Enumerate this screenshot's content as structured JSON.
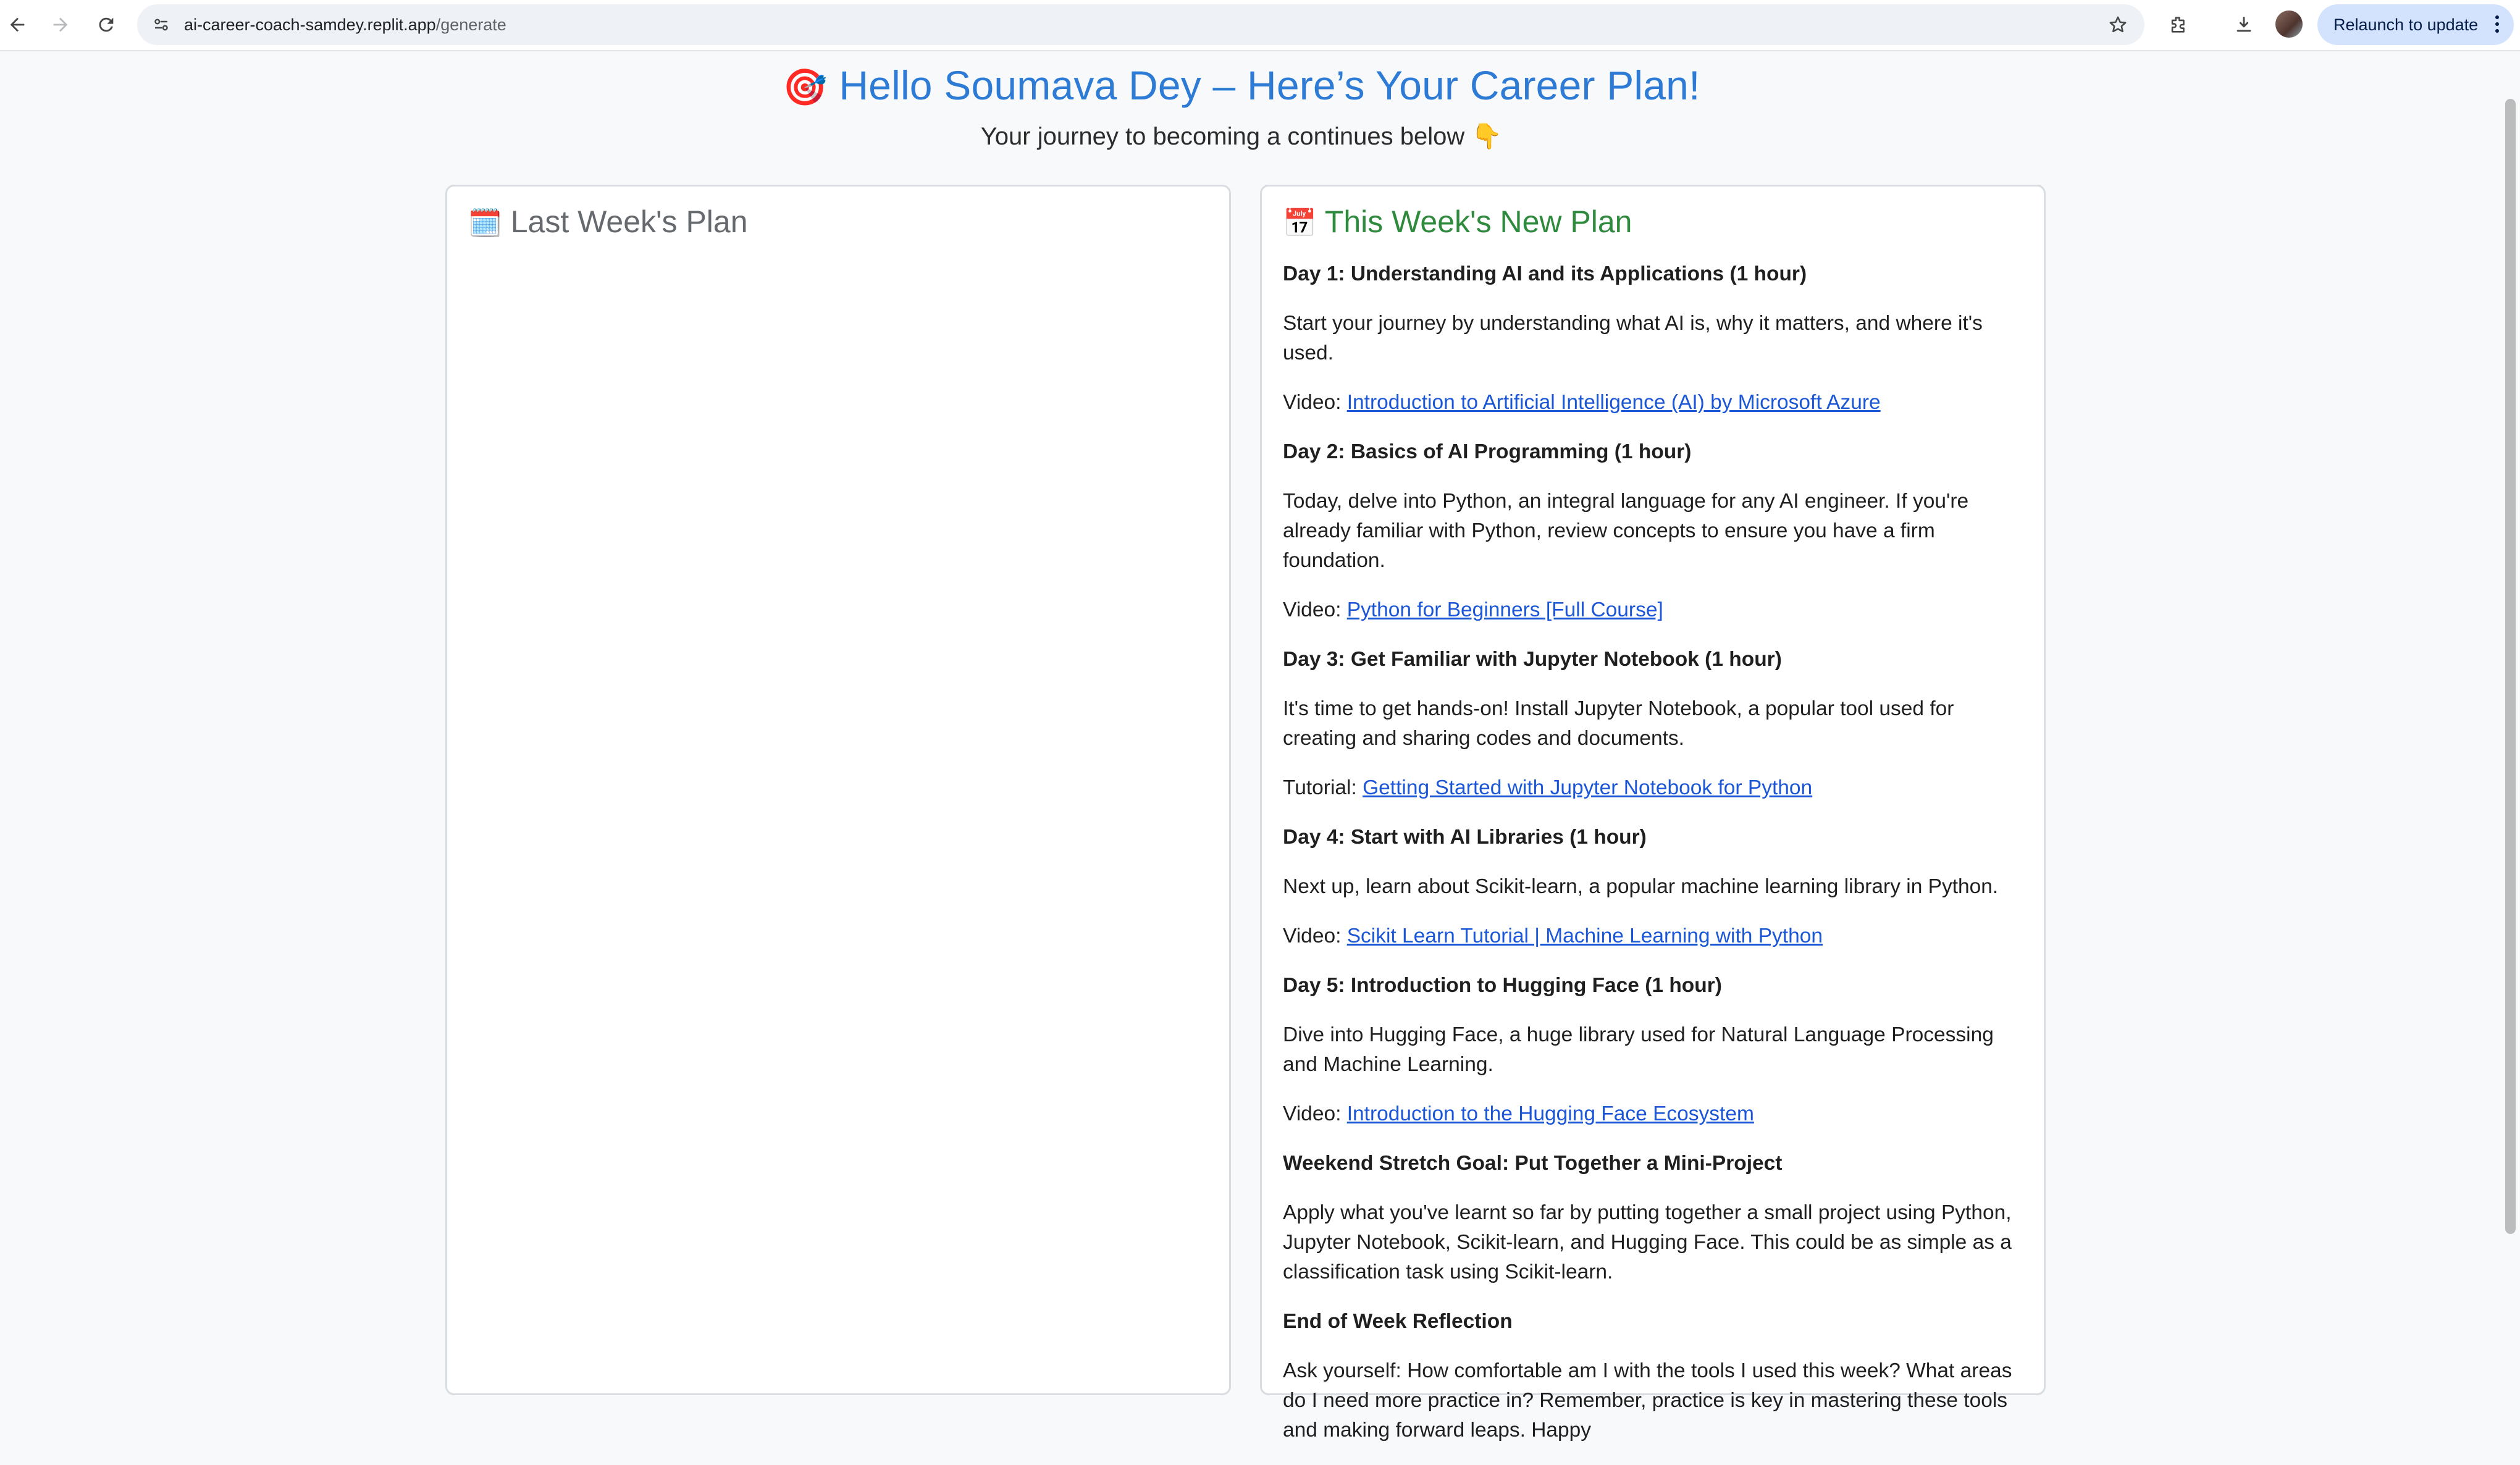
{
  "browser": {
    "url_host": "ai-career-coach-samdey.replit.app",
    "url_path": "/generate",
    "relaunch_label": "Relaunch to update"
  },
  "page": {
    "title_emoji": "🎯",
    "title": "Hello Soumava Dey – Here’s Your Career Plan!",
    "subtitle": "Your journey to becoming a continues below 👇"
  },
  "last_week": {
    "emoji": "🗓️",
    "title": "Last Week's Plan"
  },
  "this_week": {
    "emoji": "📅",
    "title": "This Week's New Plan",
    "day1": {
      "heading": "Day 1: Understanding AI and its Applications (1 hour)",
      "text": "Start your journey by understanding what AI is, why it matters, and where it's used.",
      "res_prefix": "Video: ",
      "res_link": "Introduction to Artificial Intelligence (AI) by Microsoft Azure"
    },
    "day2": {
      "heading": "Day 2: Basics of AI Programming (1 hour)",
      "text": "Today, delve into Python, an integral language for any AI engineer. If you're already familiar with Python, review concepts to ensure you have a firm foundation.",
      "res_prefix": "Video: ",
      "res_link": "Python for Beginners [Full Course]"
    },
    "day3": {
      "heading": "Day 3: Get Familiar with Jupyter Notebook (1 hour)",
      "text": "It's time to get hands-on! Install Jupyter Notebook, a popular tool used for creating and sharing codes and documents.",
      "res_prefix": "Tutorial: ",
      "res_link": "Getting Started with Jupyter Notebook for Python"
    },
    "day4": {
      "heading": "Day 4: Start with AI Libraries (1 hour)",
      "text": "Next up, learn about Scikit-learn, a popular machine learning library in Python.",
      "res_prefix": "Video: ",
      "res_link": "Scikit Learn Tutorial | Machine Learning with Python"
    },
    "day5": {
      "heading": "Day 5: Introduction to Hugging Face (1 hour)",
      "text": "Dive into Hugging Face, a huge library used for Natural Language Processing and Machine Learning.",
      "res_prefix": "Video: ",
      "res_link": "Introduction to the Hugging Face Ecosystem"
    },
    "weekend": {
      "heading": "Weekend Stretch Goal: Put Together a Mini-Project",
      "text": "Apply what you've learnt so far by putting together a small project using Python, Jupyter Notebook, Scikit-learn, and Hugging Face. This could be as simple as a classification task using Scikit-learn."
    },
    "reflection": {
      "heading": "End of Week Reflection",
      "text": "Ask yourself: How comfortable am I with the tools I used this week? What areas do I need more practice in? Remember, practice is key in mastering these tools and making forward leaps. Happy"
    }
  }
}
